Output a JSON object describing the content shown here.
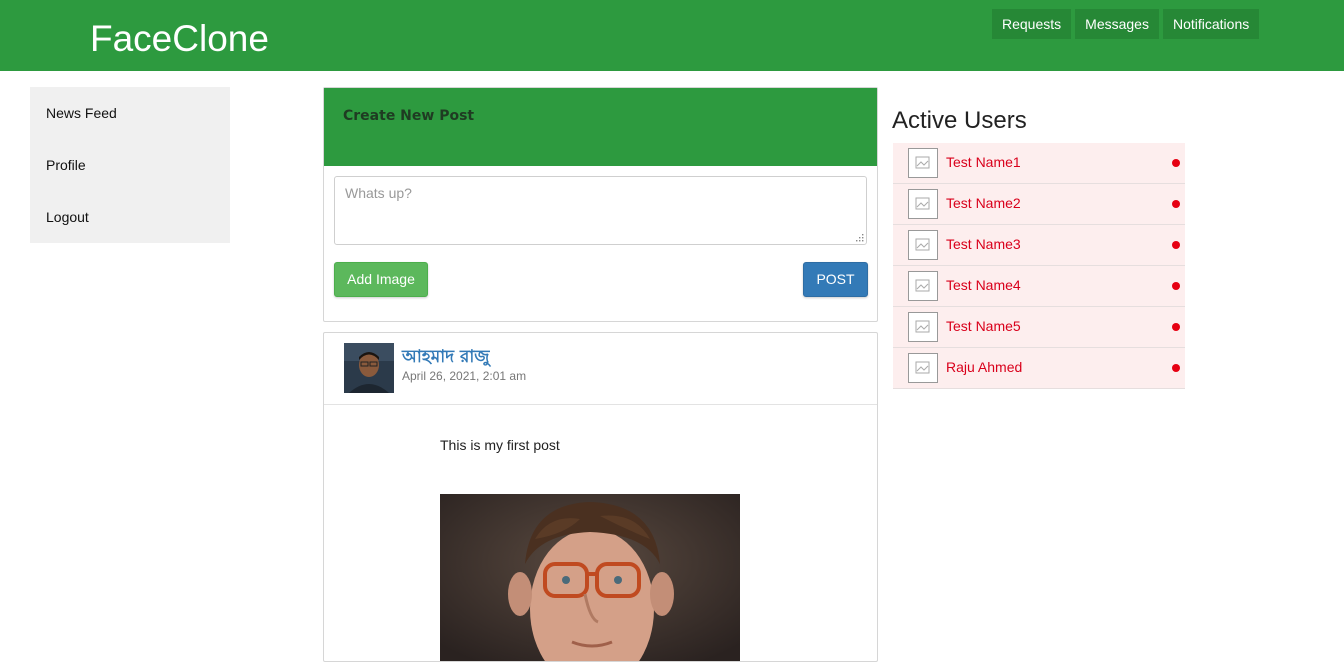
{
  "header": {
    "brand": "FaceClone",
    "nav": [
      "Requests",
      "Messages",
      "Notifications"
    ],
    "color": "#2d9a3f"
  },
  "sidebar": {
    "items": [
      "News Feed",
      "Profile",
      "Logout"
    ]
  },
  "create_post": {
    "title": "Create New Post",
    "placeholder": "Whats up?",
    "add_image_label": "Add Image",
    "post_label": "POST"
  },
  "post": {
    "author": "আহমাদ রাজু",
    "date": "April 26, 2021, 2:01 am",
    "text": "This is my first post"
  },
  "active_users": {
    "title": "Active Users",
    "users": [
      "Test Name1",
      "Test Name2",
      "Test Name3",
      "Test Name4",
      "Test Name5",
      "Raju Ahmed"
    ],
    "status_color": "#e60012"
  }
}
